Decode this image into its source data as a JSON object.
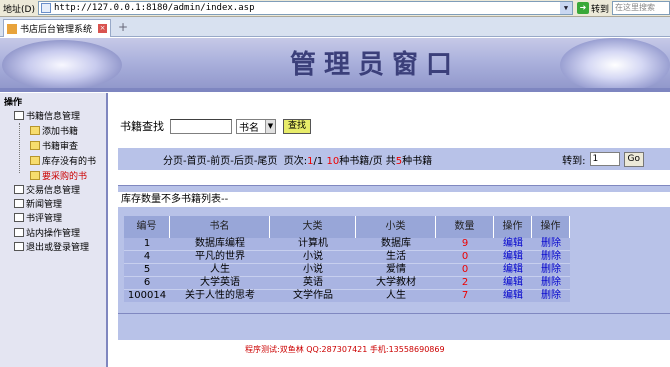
{
  "browser": {
    "address_label": "地址(D)",
    "url": "http://127.0.0.1:8180/admin/index.asp",
    "go_label": "转到",
    "search_placeholder": "在这里搜索",
    "tab_title": "书店后台管理系统"
  },
  "banner": {
    "title": "管理员窗口"
  },
  "sidebar": {
    "header": "操作",
    "items": [
      {
        "label": "书籍信息管理"
      },
      {
        "label": "添加书籍"
      },
      {
        "label": "书籍审查"
      },
      {
        "label": "库存没有的书"
      },
      {
        "label": "要采购的书"
      },
      {
        "label": "交易信息管理"
      },
      {
        "label": "新闻管理"
      },
      {
        "label": "书评管理"
      },
      {
        "label": "站内操作管理"
      },
      {
        "label": "退出或登录管理"
      }
    ]
  },
  "search": {
    "label": "书籍查找",
    "input_value": "",
    "select_value": "书名",
    "button_label": "查找"
  },
  "pager": {
    "nav_text": "分页-首页-前页-后页-尾页",
    "page_label": "页次:",
    "current_page": "1",
    "total_pages": "/1",
    "per_page": "10",
    "per_page_suffix": "种书籍/页",
    "total_prefix": "共",
    "total": "5",
    "total_suffix": "种书籍",
    "goto_label": "转到:",
    "goto_value": "1",
    "goto_button": "Go"
  },
  "list": {
    "title": "库存数量不多书籍列表--",
    "columns": [
      "编号",
      "书名",
      "大类",
      "小类",
      "数量",
      "操作",
      "操作"
    ],
    "rows": [
      {
        "id": "1",
        "name": "数据库编程",
        "category": "计算机",
        "subcategory": "数据库",
        "qty": "9",
        "edit": "编辑",
        "delete": "删除"
      },
      {
        "id": "4",
        "name": "平凡的世界",
        "category": "小说",
        "subcategory": "生活",
        "qty": "0",
        "edit": "编辑",
        "delete": "删除"
      },
      {
        "id": "5",
        "name": "人生",
        "category": "小说",
        "subcategory": "爱情",
        "qty": "0",
        "edit": "编辑",
        "delete": "删除"
      },
      {
        "id": "6",
        "name": "大学英语",
        "category": "英语",
        "subcategory": "大学教材",
        "qty": "2",
        "edit": "编辑",
        "delete": "删除"
      },
      {
        "id": "100014",
        "name": "关于人性的思考",
        "category": "文学作品",
        "subcategory": "人生",
        "qty": "7",
        "edit": "编辑",
        "delete": "删除"
      }
    ]
  },
  "footer": {
    "text": "程序测试:双鱼林 QQ:287307421 手机:13558690869"
  }
}
